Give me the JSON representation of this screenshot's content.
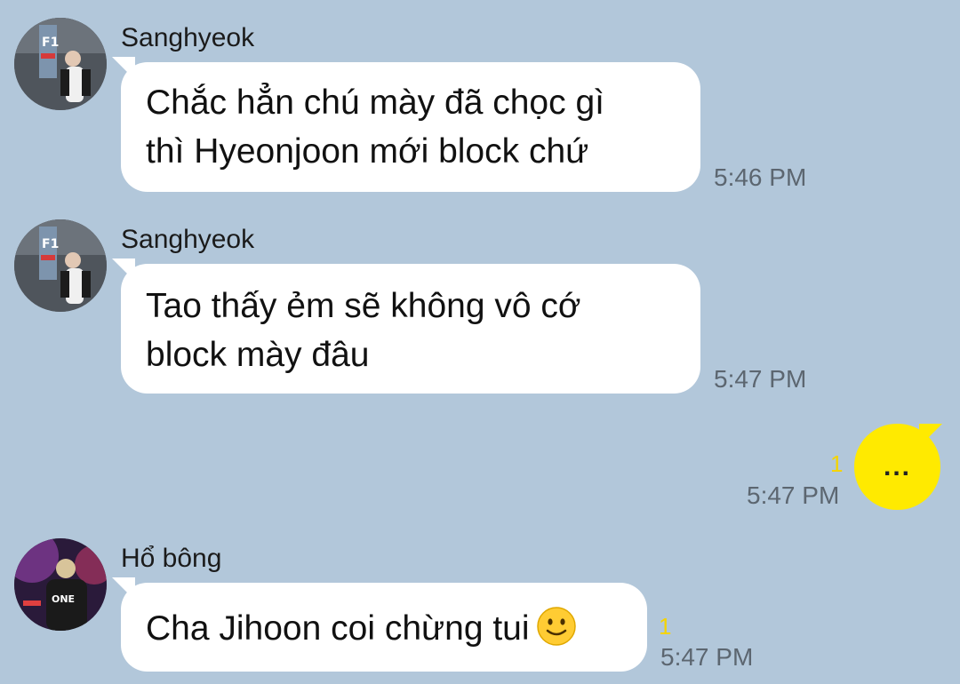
{
  "messages": [
    {
      "sender": "Sanghyeok",
      "lines": [
        "Chắc hẳn chú mày đã chọc gì",
        "thì Hyeonjoon mới block chứ"
      ],
      "time": "5:46 PM",
      "avatar": "sanghyeok-avatar"
    },
    {
      "sender": "Sanghyeok",
      "lines": [
        "Tao thấy ẻm sẽ không vô cớ",
        "block mày đâu"
      ],
      "time": "5:47 PM",
      "avatar": "sanghyeok-avatar"
    },
    {
      "outgoing": true,
      "text": "...",
      "unread": "1",
      "time": "5:47 PM"
    },
    {
      "sender": "Hổ bông",
      "text": "Cha Jihoon coi chừng tui",
      "emoji": "slightly-smiling-face",
      "unread": "1",
      "time": "5:47 PM",
      "avatar": "ho-bong-avatar"
    }
  ],
  "colors": {
    "background": "#b2c7da",
    "incoming_bubble": "#ffffff",
    "outgoing_bubble": "#ffea00",
    "unread_count": "#f5d400",
    "timestamp": "#5c6670"
  }
}
